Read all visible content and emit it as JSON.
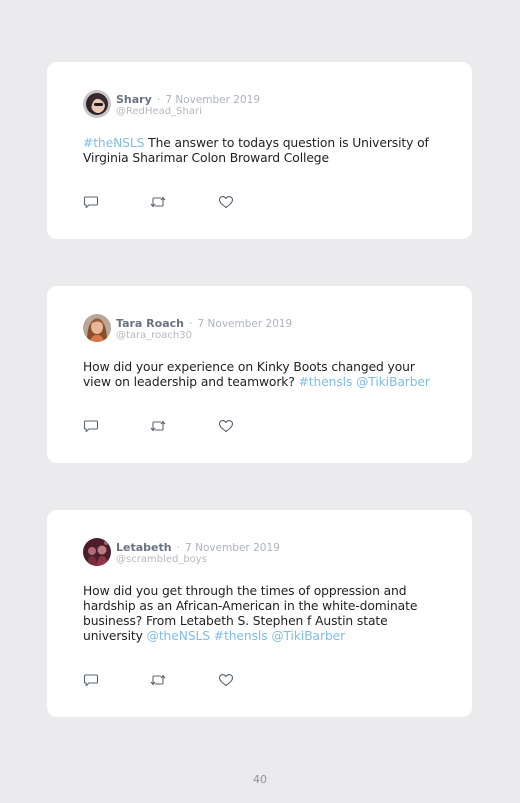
{
  "tweets": [
    {
      "name": "Shary",
      "separator": "·",
      "date": "7 November 2019",
      "handle": "@RedHead_Shari",
      "text_parts": [
        {
          "text": "#theNSLS",
          "link": true
        },
        {
          "text": " The answer to todays question is University of Virginia Sharimar Colon Broward College",
          "link": false
        }
      ]
    },
    {
      "name": "Tara Roach",
      "separator": "·",
      "date": "7 November 2019",
      "handle": "@tara_roach30",
      "text_parts": [
        {
          "text": "How did your experience on Kinky Boots changed your view on leadership and teamwork? ",
          "link": false
        },
        {
          "text": "#thensls",
          "link": true
        },
        {
          "text": " ",
          "link": false
        },
        {
          "text": "@TikiBarber",
          "link": true
        }
      ]
    },
    {
      "name": "Letabeth",
      "separator": "·",
      "date": "7 November 2019",
      "handle": "@scrambled_boys",
      "text_parts": [
        {
          "text": "How did you get through the times of oppression and hardship as an African-American in the white-dominate business? From Letabeth S. Stephen f Austin state university ",
          "link": false
        },
        {
          "text": "@theNSLS",
          "link": true
        },
        {
          "text": " ",
          "link": false
        },
        {
          "text": "#thensls",
          "link": true
        },
        {
          "text": " ",
          "link": false
        },
        {
          "text": "@TikiBarber",
          "link": true
        }
      ]
    }
  ],
  "actions": {
    "reply_icon": "reply-icon",
    "retweet_icon": "retweet-icon",
    "like_icon": "heart-icon"
  },
  "colors": {
    "background": "#ebebee",
    "card": "#ffffff",
    "link": "#7fbde4",
    "name": "#6a7480",
    "meta": "#aeb4bb",
    "icon": "#5a6570"
  },
  "page_number": "40"
}
